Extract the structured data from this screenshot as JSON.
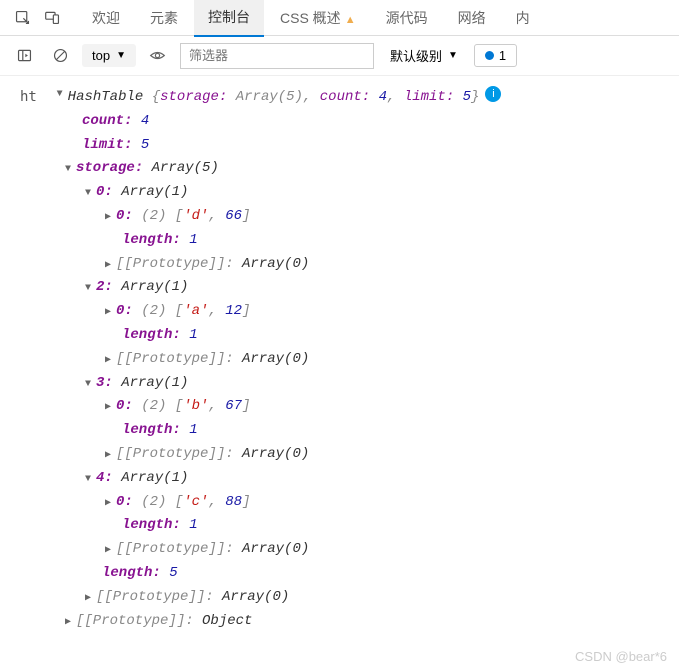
{
  "tabs": {
    "welcome": "欢迎",
    "elements": "元素",
    "console": "控制台",
    "css_overview": "CSS 概述",
    "sources": "源代码",
    "network": "网络",
    "internal": "内"
  },
  "toolbar": {
    "context": "top",
    "filter_placeholder": "筛选器",
    "levels": "默认级别",
    "issues_count": "1"
  },
  "watermark": "CSDN @bear*6",
  "log": {
    "var": "ht",
    "class": "HashTable",
    "summary_storage_label": "storage:",
    "summary_storage_val": "Array(5)",
    "summary_count_label": "count:",
    "summary_count_val": "4",
    "summary_limit_label": "limit:",
    "summary_limit_val": "5",
    "count_label": "count:",
    "count_val": "4",
    "limit_label": "limit:",
    "limit_val": "5",
    "storage_label": "storage:",
    "storage_val": "Array(5)",
    "items": [
      {
        "idx": "0",
        "arr": "Array(1)",
        "inner_idx": "0",
        "len": "(2)",
        "pair": "['d', 66]",
        "str": "'d'",
        "num": "66"
      },
      {
        "idx": "2",
        "arr": "Array(1)",
        "inner_idx": "0",
        "len": "(2)",
        "pair": "['a', 12]",
        "str": "'a'",
        "num": "12"
      },
      {
        "idx": "3",
        "arr": "Array(1)",
        "inner_idx": "0",
        "len": "(2)",
        "pair": "['b', 67]",
        "str": "'b'",
        "num": "67"
      },
      {
        "idx": "4",
        "arr": "Array(1)",
        "inner_idx": "0",
        "len": "(2)",
        "pair": "['c', 88]",
        "str": "'c'",
        "num": "88"
      }
    ],
    "length_label": "length:",
    "length1": "1",
    "length5": "5",
    "proto_label": "[[Prototype]]:",
    "proto_arr": "Array(0)",
    "proto_obj": "Object"
  },
  "chart_data": {
    "type": "table",
    "title": "HashTable console dump",
    "object": {
      "class": "HashTable",
      "count": 4,
      "limit": 5,
      "storage": {
        "length": 5,
        "0": [
          [
            "d",
            66
          ]
        ],
        "2": [
          [
            "a",
            12
          ]
        ],
        "3": [
          [
            "b",
            67
          ]
        ],
        "4": [
          [
            "c",
            88
          ]
        ]
      }
    }
  }
}
